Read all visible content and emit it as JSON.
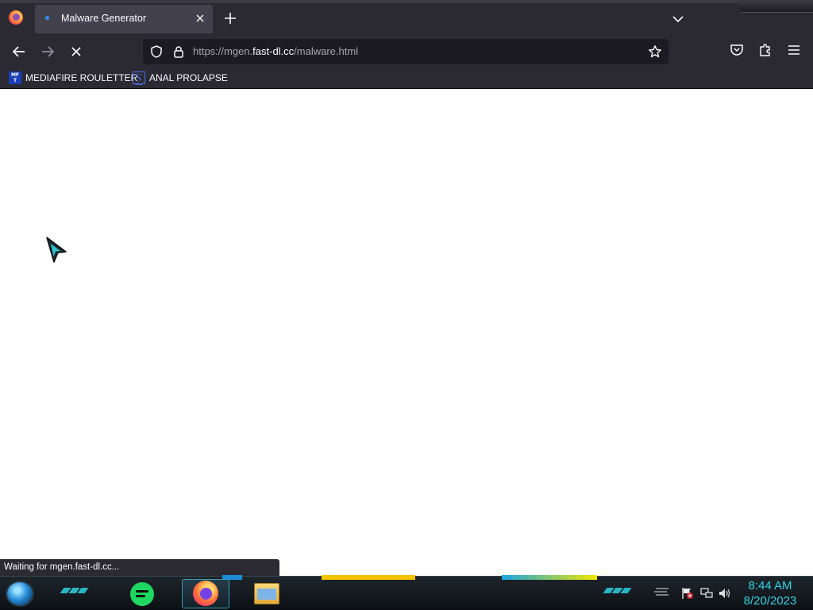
{
  "browser": {
    "active_tab": {
      "title": "Malware Generator"
    },
    "url": {
      "scheme_prefix": "https://mgen.",
      "host": "fast-dl.cc",
      "path": "/malware.html"
    },
    "bookmarks": [
      {
        "label": "MEDIAFIRE ROULETTER",
        "icon": "mediafire-icon",
        "icon_text": "MF T"
      },
      {
        "label": "ANAL PROLAPSE",
        "icon": "sigma-icon"
      }
    ],
    "status_text": "Waiting for mgen.fast-dl.cc...",
    "loading": true
  },
  "taskbar": {
    "apps": [
      "spotify-icon",
      "firefox-icon",
      "file-explorer-icon"
    ],
    "active_app": "firefox-icon",
    "tray_icons": [
      "bars-icon",
      "flag-icon",
      "network-icon",
      "volume-icon"
    ],
    "clock": {
      "time": "8:44 AM",
      "date": "8/20/2023"
    }
  },
  "colors": {
    "chrome_bg": "#2b2a33",
    "active_tab": "#42414d",
    "urlbar_bg": "#1c1b22",
    "accent_cyan": "#33d3e4"
  }
}
